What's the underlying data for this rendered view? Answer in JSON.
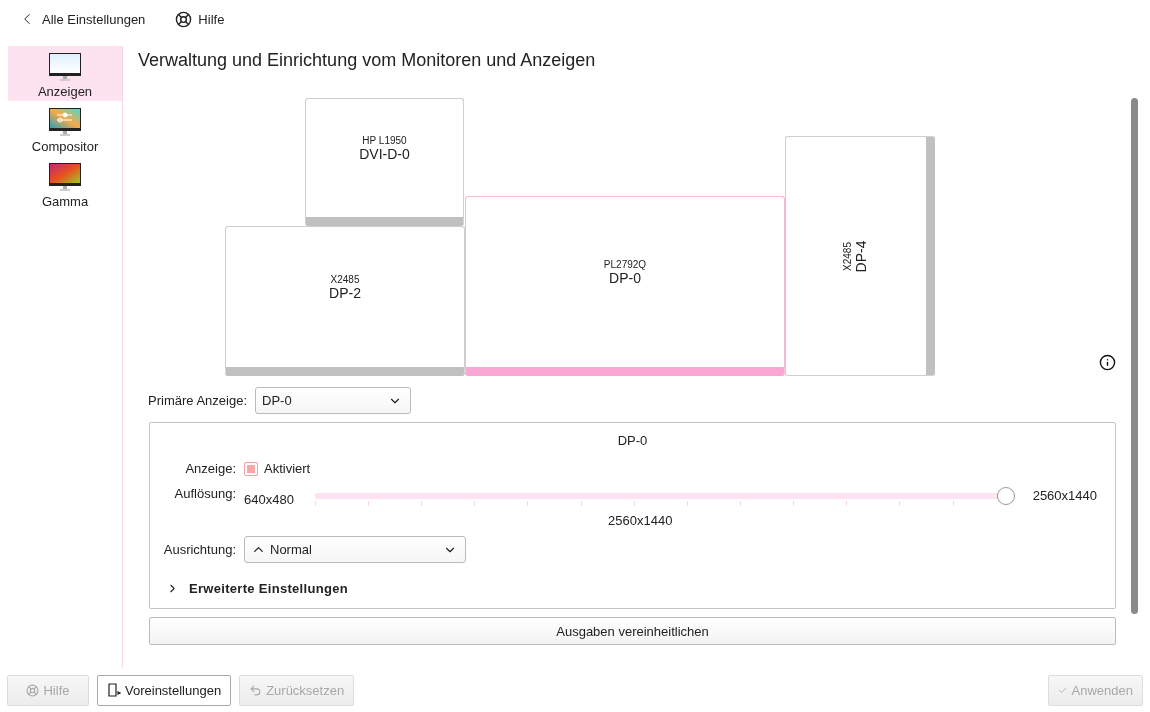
{
  "topbar": {
    "back": "Alle Einstellungen",
    "help": "Hilfe"
  },
  "sidebar": {
    "items": [
      {
        "label": "Anzeigen",
        "kind": "display",
        "selected": true
      },
      {
        "label": "Compositor",
        "kind": "compositor",
        "selected": false
      },
      {
        "label": "Gamma",
        "kind": "gamma",
        "selected": false
      }
    ]
  },
  "title": "Verwaltung und Einrichtung vom Monitoren und Anzeigen",
  "monitors": [
    {
      "model": "HP L1950",
      "output": "DVI-D-0",
      "selected": false,
      "rotated": false
    },
    {
      "model": "X2485",
      "output": "DP-2",
      "selected": false,
      "rotated": false
    },
    {
      "model": "PL2792Q",
      "output": "DP-0",
      "selected": true,
      "rotated": false
    },
    {
      "model": "X2485",
      "output": "DP-4",
      "selected": false,
      "rotated": true
    }
  ],
  "primary": {
    "label": "Primäre Anzeige:",
    "value": "DP-0"
  },
  "panel": {
    "title": "DP-0",
    "display_label": "Anzeige:",
    "enabled_label": "Aktiviert",
    "enabled": true,
    "resolution_label": "Auflösung:",
    "resolution_min": "640x480",
    "resolution_max": "2560x1440",
    "resolution_value": "2560x1440",
    "level": 1,
    "orientation_label": "Ausrichtung:",
    "orientation_value": "Normal",
    "advanced": {
      "label": "Erweiterte Einstellungen",
      "expanded": false
    }
  },
  "unify_button": "Ausgaben vereinheitlichen",
  "footer": [
    {
      "label": "Hilfe",
      "kind": "help",
      "disabled": true
    },
    {
      "label": "Voreinstellungen",
      "kind": "defaults",
      "disabled": false
    },
    {
      "label": "Zurücksetzen",
      "kind": "reset",
      "disabled": true
    },
    {
      "label": "Anwenden",
      "kind": "apply",
      "disabled": true
    }
  ]
}
